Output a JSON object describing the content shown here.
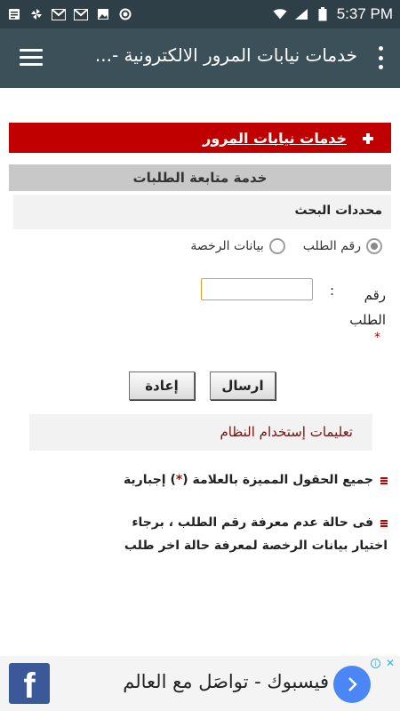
{
  "status_bar": {
    "time": "5:37 PM",
    "icons": [
      "notes-icon",
      "pinwheel-icon",
      "gmail-icon",
      "gmail-icon",
      "image-icon",
      "circle-icon",
      "wifi-icon",
      "cell-signal-icon",
      "battery-icon"
    ]
  },
  "app_bar": {
    "title": "خدمات نيابات المرور الالكترونية -..."
  },
  "section": {
    "red_link": "خدمات نيابات المرور",
    "gray_title": "خدمة متابعة الطلبات",
    "search_header": "محددات البحث"
  },
  "form": {
    "radio_request_number": "رقم الطلب",
    "radio_license_data": "بيانات الرخصة",
    "request_number_label": "رقم الطلب",
    "colon": ":",
    "required_star": "*",
    "request_number_value": "",
    "send_label": "ارسال",
    "reset_label": "إعادة"
  },
  "instructions": {
    "title": "تعليمات إستخدام النظام",
    "item1_before": "جميع الحقول المميزة بالعلامة (",
    "item1_star": "*",
    "item1_after": ") إجبارية",
    "item2": "فى حالة عدم معرفة رقم الطلب ، برجاء اختيار بيانات الرخصة لمعرفة حالة اخر طلب"
  },
  "ad": {
    "logo": "f",
    "text": "فيسبوك - تواصَل مع العالم",
    "info": "i",
    "close": "✕"
  },
  "colors": {
    "status_bar": "#2f3f48",
    "app_bar": "#3b5058",
    "red_header": "#c00000",
    "gray_title": "#c8c8c8",
    "input_border": "#e39a2e",
    "facebook_blue": "#3b5998",
    "ad_button": "#4a86f5"
  }
}
